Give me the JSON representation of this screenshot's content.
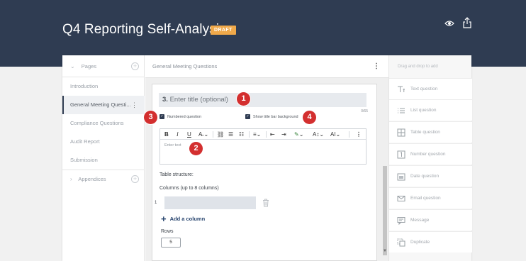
{
  "header": {
    "title": "Q4 Reporting Self-Analysis",
    "badge": "DRAFT",
    "icons": [
      "eye-icon",
      "share-icon"
    ]
  },
  "sidebar": {
    "pages_label": "Pages",
    "items": [
      {
        "label": "Introduction"
      },
      {
        "label": "General Meeting Questi..."
      },
      {
        "label": "Compliance Questions"
      },
      {
        "label": "Audit Report"
      },
      {
        "label": "Submission"
      }
    ],
    "appendices_label": "Appendices"
  },
  "editor": {
    "section_title": "General Meeting Questions",
    "question_number": "3.",
    "title_placeholder": "Enter title (optional)",
    "char_counter": "0/65",
    "numbered_label": "Numbered question",
    "title_bg_label": "Show title bar background",
    "body_placeholder": "Enter text",
    "table_structure_label": "Table structure:",
    "columns_label": "Columns (up to 8 columns)",
    "column_index": "1",
    "add_column_label": "Add a column",
    "rows_label": "Rows",
    "rows_value": "5"
  },
  "callouts": [
    "1",
    "2",
    "3",
    "4"
  ],
  "right_panel": {
    "heading": "Drag and drop to add",
    "items": [
      {
        "label": "Text question",
        "icon": "text-icon"
      },
      {
        "label": "List question",
        "icon": "list-icon"
      },
      {
        "label": "Table question",
        "icon": "table-icon"
      },
      {
        "label": "Number question",
        "icon": "number-icon"
      },
      {
        "label": "Date question",
        "icon": "calendar-icon"
      },
      {
        "label": "Email question",
        "icon": "email-icon"
      },
      {
        "label": "Message",
        "icon": "message-icon"
      },
      {
        "label": "Duplicate",
        "icon": "duplicate-icon"
      }
    ]
  },
  "colors": {
    "header_bg": "#2f3c52",
    "badge": "#f0a94a",
    "callout": "#d32f2f",
    "accent": "#27446e"
  }
}
